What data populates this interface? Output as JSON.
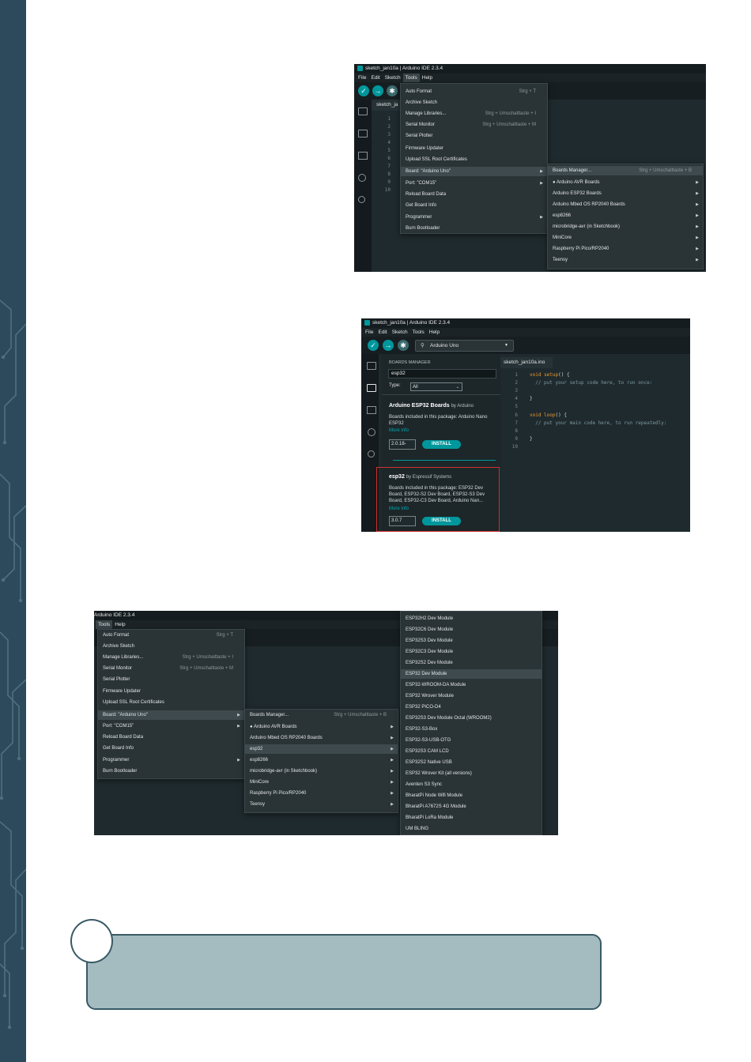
{
  "screenshot1": {
    "title": "sketch_jan10a | Arduino IDE 2.3.4",
    "menu": [
      "File",
      "Edit",
      "Sketch",
      "Tools",
      "Help"
    ],
    "tab": "sketch_ja",
    "line_numbers": [
      "1",
      "2",
      "3",
      "4",
      "5",
      "6",
      "7",
      "8",
      "9",
      "10"
    ],
    "tools_menu": [
      {
        "label": "Auto Format",
        "shortcut": "Strg + T"
      },
      {
        "label": "Archive Sketch",
        "shortcut": ""
      },
      {
        "label": "Manage Libraries...",
        "shortcut": "Strg + Umschalttaste + I"
      },
      {
        "label": "Serial Monitor",
        "shortcut": "Strg + Umschalttaste + M"
      },
      {
        "label": "Serial Plotter",
        "shortcut": ""
      },
      {
        "label": "Firmware Updater",
        "shortcut": ""
      },
      {
        "label": "Upload SSL Root Certificates",
        "shortcut": ""
      },
      {
        "label": "Board: \"Arduino Uno\"",
        "shortcut": ""
      },
      {
        "label": "Port: \"COM15\"",
        "shortcut": ""
      },
      {
        "label": "Reload Board Data",
        "shortcut": ""
      },
      {
        "label": "Get Board Info",
        "shortcut": ""
      },
      {
        "label": "Programmer",
        "shortcut": ""
      },
      {
        "label": "Burn Bootloader",
        "shortcut": ""
      }
    ],
    "board_submenu": [
      {
        "label": "Boards Manager...",
        "shortcut": "Strg + Umschalttaste + B"
      },
      {
        "label": "● Arduino AVR Boards",
        "shortcut": ""
      },
      {
        "label": "Arduino ESP32 Boards",
        "shortcut": ""
      },
      {
        "label": "Arduino Mbed OS RP2040 Boards",
        "shortcut": ""
      },
      {
        "label": "esp8266",
        "shortcut": ""
      },
      {
        "label": "microbridge-avr (in Sketchbook)",
        "shortcut": ""
      },
      {
        "label": "MiniCore",
        "shortcut": ""
      },
      {
        "label": "Raspberry Pi Pico/RP2040",
        "shortcut": ""
      },
      {
        "label": "Teensy",
        "shortcut": ""
      }
    ]
  },
  "screenshot2": {
    "title": "sketch_jan10a | Arduino IDE 2.3.4",
    "menu": [
      "File",
      "Edit",
      "Sketch",
      "Tools",
      "Help"
    ],
    "board_select": "Arduino Uno",
    "panel_title": "BOARDS MANAGER",
    "search_value": "esp32",
    "type_label": "Type:",
    "type_value": "All",
    "card1": {
      "name": "Arduino ESP32 Boards",
      "by": "by Arduino",
      "desc": "Boards included in this package: Arduino Nano ESP32",
      "more": "More info",
      "version": "2.0.18-",
      "install": "INSTALL"
    },
    "card2": {
      "name": "esp32",
      "by": "by Espressif Systems",
      "desc": "Boards included in this package: ESP32 Dev Board, ESP32-S2 Dev Board, ESP32-S3 Dev Board, ESP32-C3 Dev Board, Arduino Nan...",
      "more": "More info",
      "version": "3.0.7",
      "install": "INSTALL"
    },
    "highlight_color": "#d0302f",
    "tab": "sketch_jan10a.ino",
    "line_numbers": [
      "1",
      "2",
      "3",
      "4",
      "5",
      "6",
      "7",
      "8",
      "9",
      "10"
    ],
    "code": {
      "l1a": "void ",
      "l1b": "setup",
      "l1c": "() {",
      "l2": "  // put your setup code here, to run once:",
      "l4": "}",
      "l6a": "void ",
      "l6b": "loop",
      "l6c": "() {",
      "l7": "  // put your main code here, to run repeatedly:",
      "l9": "}"
    }
  },
  "screenshot3": {
    "title": "Arduino IDE 2.3.4",
    "menu": [
      "Tools",
      "Help"
    ],
    "tools_menu": [
      {
        "label": "Auto Format",
        "shortcut": "Strg + T"
      },
      {
        "label": "Archive Sketch",
        "shortcut": ""
      },
      {
        "label": "Manage Libraries...",
        "shortcut": "Strg + Umschalttaste + I"
      },
      {
        "label": "Serial Monitor",
        "shortcut": "Strg + Umschalttaste + M"
      },
      {
        "label": "Serial Plotter",
        "shortcut": ""
      },
      {
        "label": "Firmware Updater",
        "shortcut": ""
      },
      {
        "label": "Upload SSL Root Certificates",
        "shortcut": ""
      },
      {
        "label": "Board: \"Arduino Uno\"",
        "shortcut": ""
      },
      {
        "label": "Port: \"COM15\"",
        "shortcut": ""
      },
      {
        "label": "Reload Board Data",
        "shortcut": ""
      },
      {
        "label": "Get Board Info",
        "shortcut": ""
      },
      {
        "label": "Programmer",
        "shortcut": ""
      },
      {
        "label": "Burn Bootloader",
        "shortcut": ""
      }
    ],
    "board_submenu": [
      {
        "label": "Boards Manager...",
        "shortcut": "Strg + Umschalttaste + B"
      },
      {
        "label": "● Arduino AVR Boards",
        "shortcut": ""
      },
      {
        "label": "Arduino Mbed OS RP2040 Boards",
        "shortcut": ""
      },
      {
        "label": "esp32",
        "shortcut": ""
      },
      {
        "label": "esp8266",
        "shortcut": ""
      },
      {
        "label": "microbridge-avr (in Sketchbook)",
        "shortcut": ""
      },
      {
        "label": "MiniCore",
        "shortcut": ""
      },
      {
        "label": "Raspberry Pi Pico/RP2040",
        "shortcut": ""
      },
      {
        "label": "Teensy",
        "shortcut": ""
      }
    ],
    "esp32_list": [
      "ESP32H2 Dev Module",
      "ESP32C6 Dev Module",
      "ESP32S3 Dev Module",
      "ESP32C3 Dev Module",
      "ESP32S2 Dev Module",
      "ESP32 Dev Module",
      "ESP32-WROOM-DA Module",
      "ESP32 Wrover Module",
      "ESP32 PICO-D4",
      "ESP32S3 Dev Module Octal (WROOM2)",
      "ESP32-S3-Box",
      "ESP32-S3-USB-OTG",
      "ESP32S3 CAM LCD",
      "ESP32S2 Native USB",
      "ESP32 Wrover Kit (all versions)",
      "Aventen S3 Sync",
      "BharatPi Node Wifi Module",
      "BharatPi A7672S 4G Module",
      "BharatPi LoRa Module",
      "UM BLING"
    ]
  }
}
